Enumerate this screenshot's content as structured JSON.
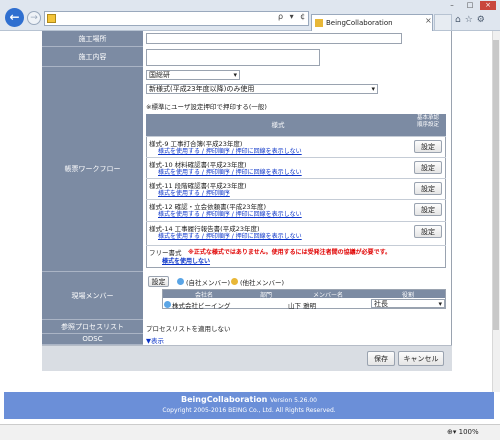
{
  "browser": {
    "tab_title": "BeingCollaboration",
    "addr_tools": "ρ ▾ ¢",
    "zoom": "100%"
  },
  "form": {
    "labels": {
      "site": "施工場所",
      "content": "施工内容",
      "workflow": "帳票ワークフロー",
      "members": "現場メンバー",
      "process_list": "参照プロセスリスト",
      "odsc": "ODSC"
    },
    "dropdown1": "国総研",
    "dropdown2": "新様式(平成23年度以降)のみ使用",
    "default_note": "※標準にユーザ設定押印で押印する(一般)",
    "table_header": {
      "form": "様式",
      "default": "基本承認\n順序設定"
    },
    "forms": [
      {
        "title": "様式-9 工事打合簿(平成23年度)",
        "links": "様式を使用する / 押印順序 / 押印に回線を表示しない",
        "btn": "設定"
      },
      {
        "title": "様式-10 材料確認書(平成23年度)",
        "links": "様式を使用する / 押印順序 / 押印に回線を表示しない",
        "btn": "設定"
      },
      {
        "title": "様式-11 段階確認書(平成23年度)",
        "links": "様式を使用する / 押印順序",
        "btn": "設定"
      },
      {
        "title": "様式-12 確認・立会依頼書(平成23年度)",
        "links": "様式を使用する / 押印順序 / 押印に回線を表示しない",
        "btn": "設定"
      },
      {
        "title": "様式-14 工事履行報告書(平成23年度)",
        "links": "様式を使用する / 押印順序 / 押印に回線を表示しない",
        "btn": "設定"
      }
    ],
    "free_form": {
      "title": "フリー書式",
      "warning": "※正式な様式ではありません。使用するには受発注者間の協議が必要です。",
      "link": "様式を使用しない"
    },
    "members": {
      "settings_btn": "設定",
      "own_label": "(自社メンバー)",
      "other_label": "(他社メンバー)",
      "columns": [
        "会社名",
        "部門",
        "メンバー名",
        "役割"
      ],
      "rows": [
        {
          "company": "株式会社ビーイング",
          "dept": "",
          "member": "山下 雅明",
          "role": "社長"
        }
      ]
    },
    "process_list_text": "プロセスリストを適用しない",
    "odsc_link": "▼表示",
    "save_btn": "保存",
    "cancel_btn": "キャンセル"
  },
  "footer": {
    "product": "BeingCollaboration",
    "version": "Version 5.26.00",
    "copyright": "Copyright 2005-2016 BEING Co., Ltd. All Rights Reserved."
  }
}
